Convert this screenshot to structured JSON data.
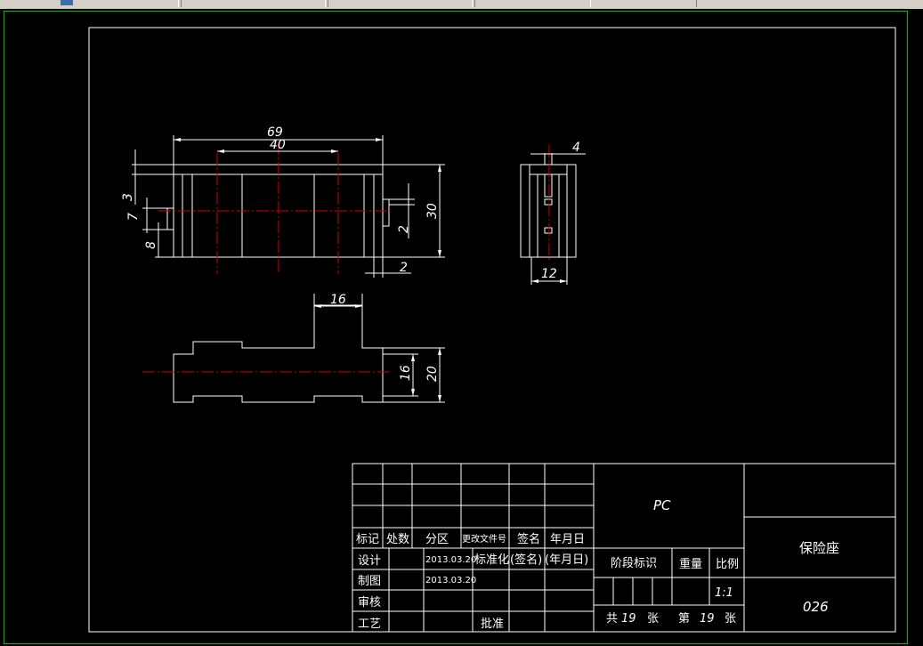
{
  "drawing": {
    "dimensions": {
      "front_overall_width": "69",
      "front_inner_width": "40",
      "front_height": "30",
      "front_left_3": "3",
      "front_left_7": "7",
      "front_left_8": "8",
      "front_right_2_upper": "2",
      "front_right_2_lower": "2",
      "side_top": "4",
      "side_width": "12",
      "bottom_slot": "16",
      "bottom_inner_height": "16",
      "bottom_height": "20"
    }
  },
  "title_block": {
    "material": "PC",
    "part_name": "保险座",
    "drawing_number": "026",
    "headers": {
      "mark": "标记",
      "count": "处数",
      "zone": "分区",
      "change_doc": "更改文件号",
      "signature": "签名",
      "date": "年月日"
    },
    "rows": {
      "design": "设计",
      "draft": "制图",
      "review": "审核",
      "process": "工艺",
      "approve": "批准",
      "standardize": "标准化",
      "sign_paren": "(签名)",
      "date_paren": "(年月日)"
    },
    "dates": {
      "design_date": "2013.03.20",
      "draft_date": "2013.03.20"
    },
    "stage_mark": "阶段标识",
    "weight": "重量",
    "scale_label": "比例",
    "scale_value": "1:1",
    "sheets_total_prefix": "共",
    "sheets_total": "19",
    "sheets_total_suffix": "张",
    "sheet_no_prefix": "第",
    "sheet_no": "19",
    "sheet_no_suffix": "张"
  }
}
